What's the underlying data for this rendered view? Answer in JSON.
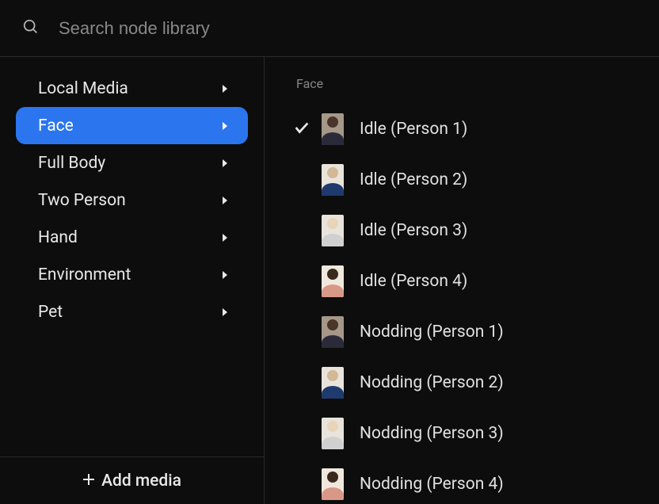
{
  "search": {
    "placeholder": "Search node library"
  },
  "sidebar": {
    "categories": [
      {
        "label": "Local Media",
        "selected": false
      },
      {
        "label": "Face",
        "selected": true
      },
      {
        "label": "Full Body",
        "selected": false
      },
      {
        "label": "Two Person",
        "selected": false
      },
      {
        "label": "Hand",
        "selected": false
      },
      {
        "label": "Environment",
        "selected": false
      },
      {
        "label": "Pet",
        "selected": false
      }
    ],
    "add_media_label": "Add media"
  },
  "content": {
    "heading": "Face",
    "items": [
      {
        "label": "Idle (Person 1)",
        "selected": true,
        "thumb": "p1"
      },
      {
        "label": "Idle (Person 2)",
        "selected": false,
        "thumb": "p2"
      },
      {
        "label": "Idle (Person 3)",
        "selected": false,
        "thumb": "p3"
      },
      {
        "label": "Idle (Person 4)",
        "selected": false,
        "thumb": "p4"
      },
      {
        "label": "Nodding (Person 1)",
        "selected": false,
        "thumb": "p1"
      },
      {
        "label": "Nodding (Person 2)",
        "selected": false,
        "thumb": "p2"
      },
      {
        "label": "Nodding (Person 3)",
        "selected": false,
        "thumb": "p3"
      },
      {
        "label": "Nodding (Person 4)",
        "selected": false,
        "thumb": "p4"
      }
    ]
  }
}
